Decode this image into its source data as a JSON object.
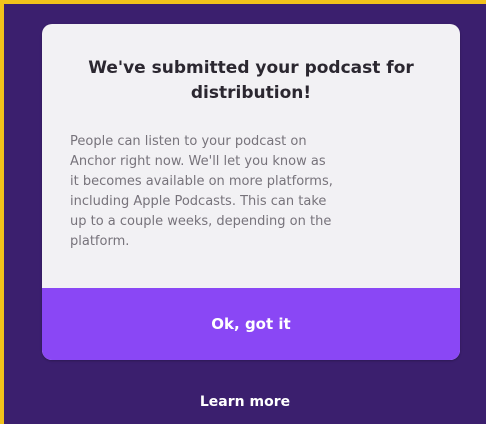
{
  "dialog": {
    "title_line1": "We've submitted your podcast for",
    "title_line2": "distribution!",
    "body_lines": [
      "People can listen to your podcast on",
      "Anchor right now. We'll let you know as",
      "it becomes available on more platforms,",
      "including Apple Podcasts. This can take",
      "up to a couple weeks, depending on the",
      "platform."
    ],
    "confirm_label": "Ok, got it"
  },
  "footer": {
    "learn_more_label": "Learn more"
  },
  "colors": {
    "outer_border": "#f2c21b",
    "background": "#3b1f6e",
    "dialog_bg": "#f2f1f4",
    "button_bg": "#8a47f5"
  }
}
